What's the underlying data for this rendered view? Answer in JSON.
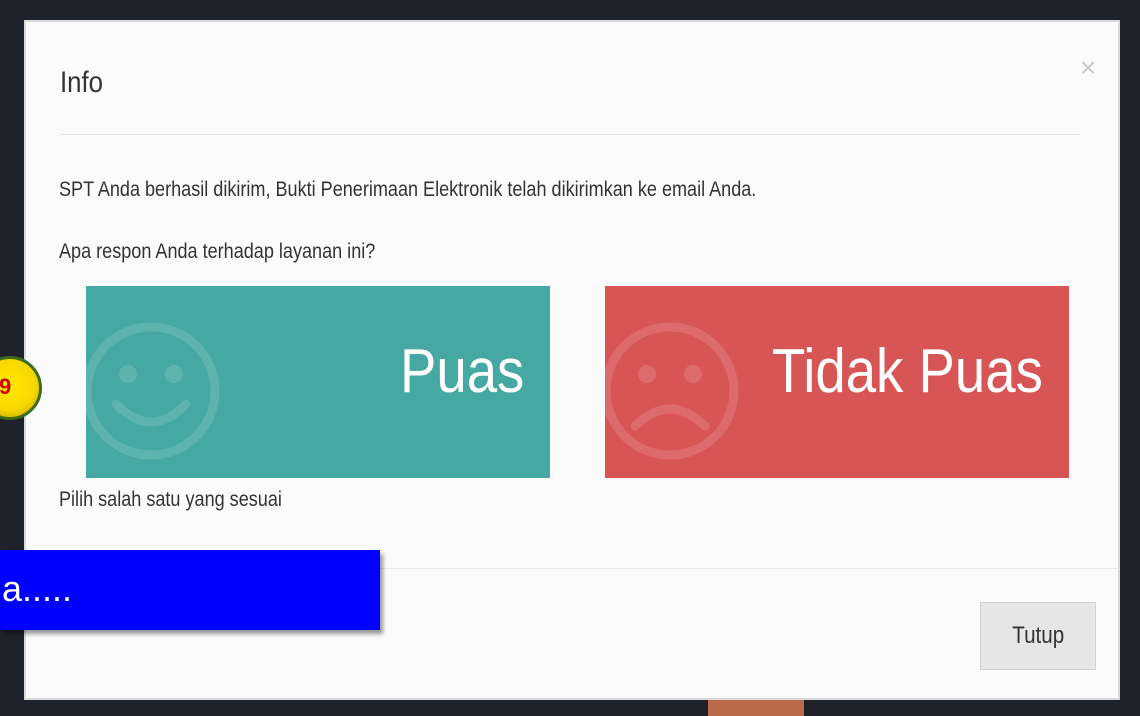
{
  "modal": {
    "title": "Info",
    "close_icon_glyph": "×",
    "message_sent": "SPT Anda berhasil dikirim, Bukti Penerimaan Elektronik telah dikirimkan ke email Anda.",
    "question": "Apa respon Anda terhadap layanan ini?",
    "hint": "Pilih salah satu yang sesuai",
    "close_button_label": "Tutup"
  },
  "rating": {
    "satisfied": {
      "label": "Puas",
      "icon": "smile-face-icon",
      "color": "#45a8a3"
    },
    "unsatisfied": {
      "label": "Tidak Puas",
      "icon": "frown-face-icon",
      "color": "#d85555"
    }
  },
  "overlay": {
    "step_badge": "9",
    "caption": "a....."
  }
}
